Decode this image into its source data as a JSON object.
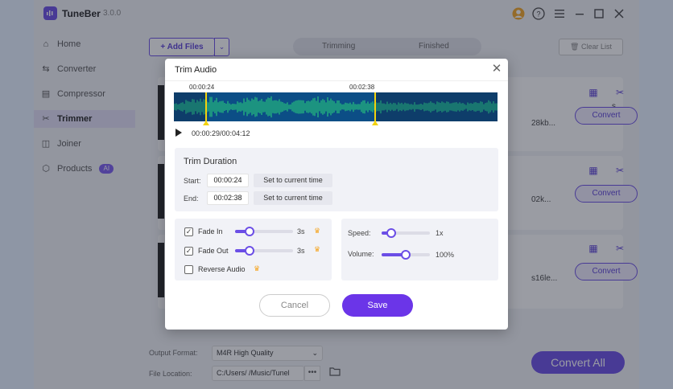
{
  "app": {
    "name": "TuneBer",
    "version": "3.0.0"
  },
  "sidebar": {
    "items": [
      {
        "label": "Home",
        "icon": "home-icon"
      },
      {
        "label": "Converter",
        "icon": "converter-icon"
      },
      {
        "label": "Compressor",
        "icon": "compressor-icon"
      },
      {
        "label": "Trimmer",
        "icon": "scissors-icon",
        "active": true
      },
      {
        "label": "Joiner",
        "icon": "joiner-icon"
      },
      {
        "label": "Products",
        "icon": "cube-icon",
        "badge": "AI"
      }
    ]
  },
  "toolbar": {
    "add_files": "+ Add Files",
    "tabs": [
      "Trimming",
      "Finished"
    ],
    "clear_list": "Clear List"
  },
  "cards": [
    {
      "ext": "s",
      "size": "28kb...",
      "convert": "Convert"
    },
    {
      "ext": "",
      "size": "02k...",
      "convert": "Convert"
    },
    {
      "ext": "",
      "size": "s16le...",
      "convert": "Convert"
    }
  ],
  "footer": {
    "output_format_label": "Output Format:",
    "output_format_value": "M4R High Quality",
    "file_location_label": "File Location:",
    "file_location_value": "C:/Users/    /Music/Tunel",
    "more": "•••",
    "convert_all": "Convert All"
  },
  "dialog": {
    "title": "Trim Audio",
    "marker_start": "00:00:24",
    "marker_end": "00:02:38",
    "playback_time": "00:00:29/00:04:12",
    "trim_duration": {
      "title": "Trim Duration",
      "start_label": "Start:",
      "start_value": "00:00:24",
      "end_label": "End:",
      "end_value": "00:02:38",
      "set_current": "Set to current time"
    },
    "effects": {
      "fade_in": {
        "label": "Fade In",
        "value": "3s",
        "checked": true,
        "level": 0.25
      },
      "fade_out": {
        "label": "Fade Out",
        "value": "3s",
        "checked": true,
        "level": 0.25
      },
      "reverse": {
        "label": "Reverse Audio",
        "checked": false
      }
    },
    "playback": {
      "speed": {
        "label": "Speed:",
        "value": "1x",
        "level": 0.2
      },
      "volume": {
        "label": "Volume:",
        "value": "100%",
        "level": 0.5
      }
    },
    "cancel": "Cancel",
    "save": "Save"
  },
  "colors": {
    "accent": "#6b4ee6",
    "wave_bg": "#0e3d6a",
    "wave_line": "#2ee07a",
    "handle": "#f3d20c"
  }
}
